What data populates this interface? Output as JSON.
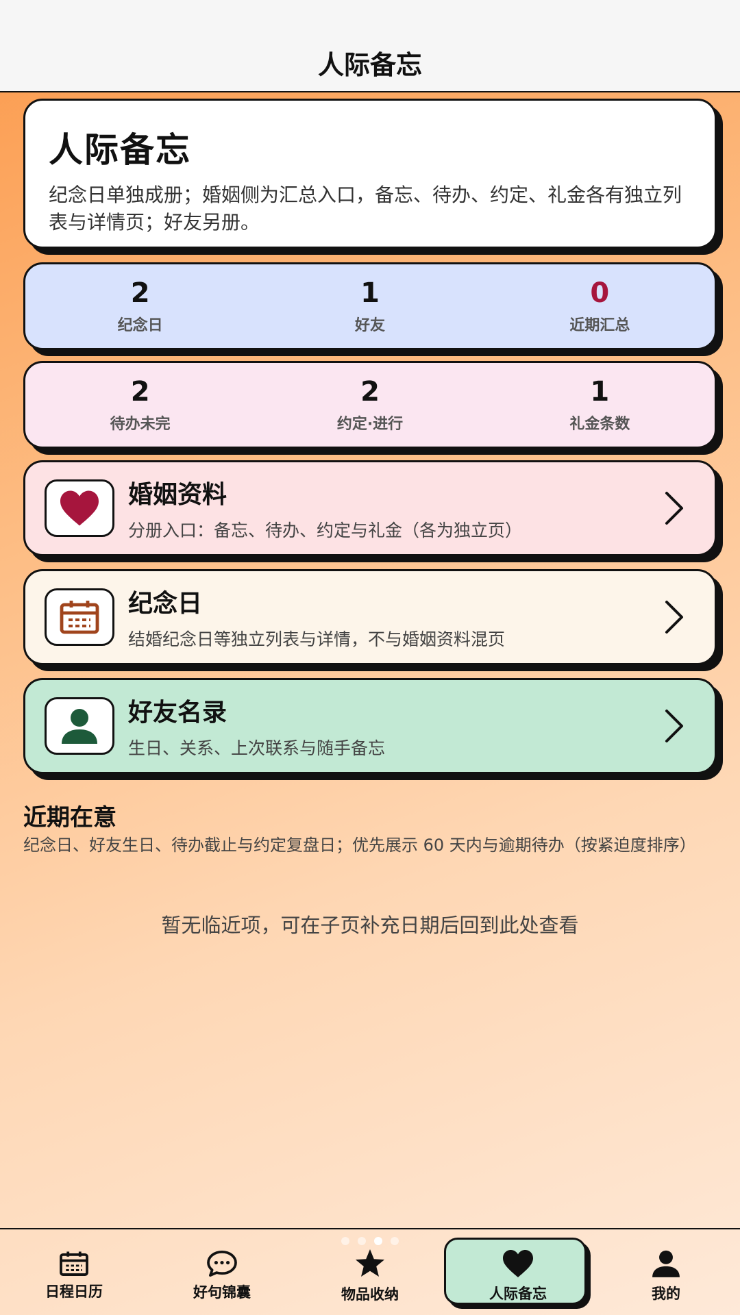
{
  "header": {
    "title": "人际备忘"
  },
  "intro": {
    "title": "人际备忘",
    "description": "纪念日单独成册；婚姻侧为汇总入口，备忘、待办、约定、礼金各有独立列表与详情页；好友另册。"
  },
  "stats_row1": [
    {
      "value": "2",
      "label": "纪念日"
    },
    {
      "value": "1",
      "label": "好友"
    },
    {
      "value": "0",
      "label": "近期汇总",
      "highlight_color": "#a6153d"
    }
  ],
  "stats_row2": [
    {
      "value": "2",
      "label": "待办未完"
    },
    {
      "value": "2",
      "label": "约定·进行"
    },
    {
      "value": "1",
      "label": "礼金条数"
    }
  ],
  "nav_cards": [
    {
      "title": "婚姻资料",
      "subtitle": "分册入口：备忘、待办、约定与礼金（各为独立页）",
      "icon": "heart-icon",
      "color": "#fde2e4"
    },
    {
      "title": "纪念日",
      "subtitle": "结婚纪念日等独立列表与详情，不与婚姻资料混页",
      "icon": "calendar-icon",
      "color": "#fdf5ea"
    },
    {
      "title": "好友名录",
      "subtitle": "生日、关系、上次联系与随手备忘",
      "icon": "person-icon",
      "color": "#c2e9d4"
    }
  ],
  "recent": {
    "title": "近期在意",
    "description": "纪念日、好友生日、待办截止与约定复盘日；优先展示 60 天内与逾期待办（按紧迫度排序）",
    "empty_text": "暂无临近项，可在子页补充日期后回到此处查看"
  },
  "tabs": [
    {
      "label": "日程日历",
      "icon": "calendar-icon"
    },
    {
      "label": "好句锦囊",
      "icon": "chat-bubble-icon"
    },
    {
      "label": "物品收纳",
      "icon": "star-icon"
    },
    {
      "label": "人际备忘",
      "icon": "heart-icon",
      "active": true
    },
    {
      "label": "我的",
      "icon": "person-icon"
    }
  ],
  "pager": {
    "pages": 4,
    "current": 3
  }
}
